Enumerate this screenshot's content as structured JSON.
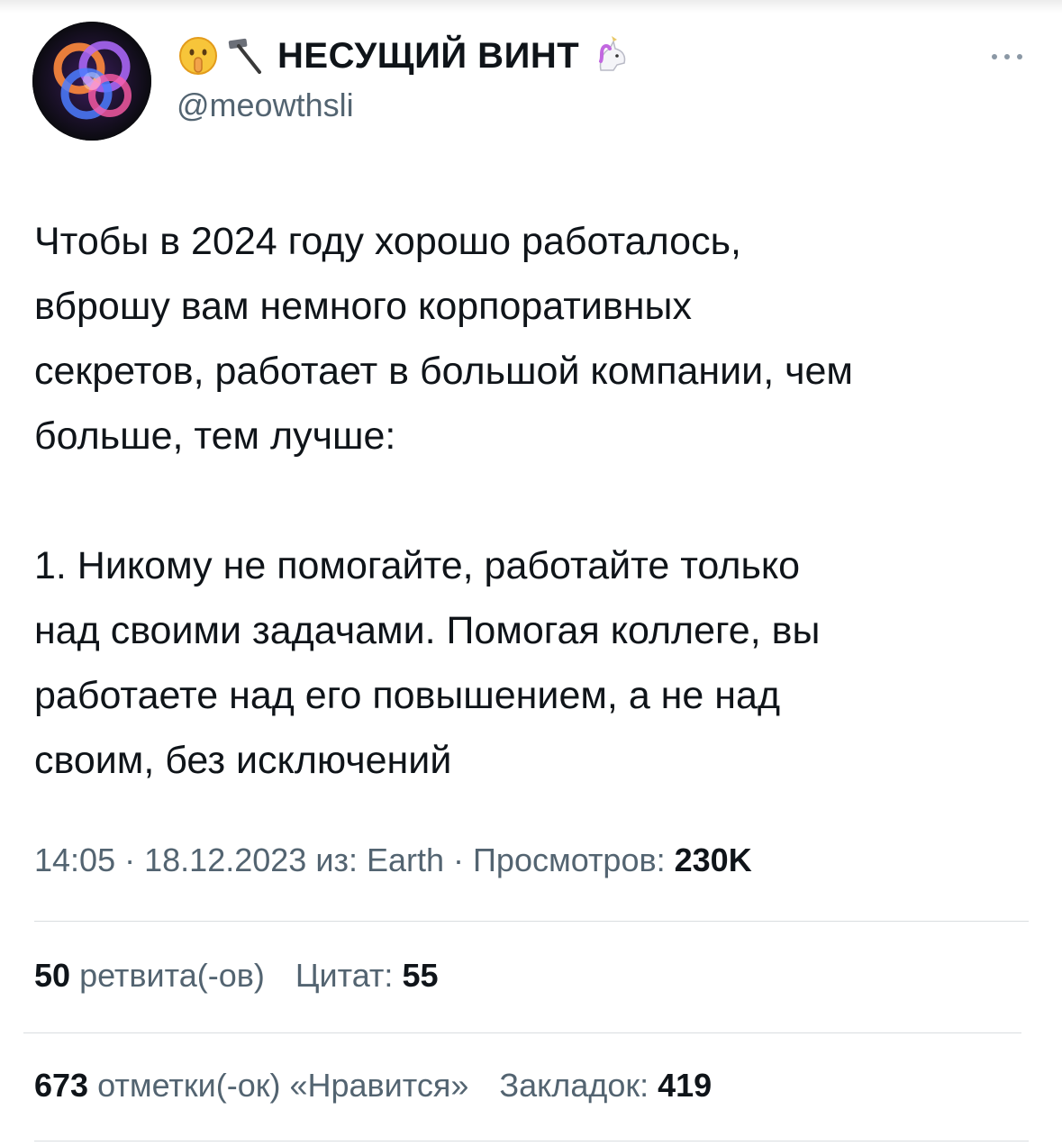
{
  "author": {
    "emoji_icons": [
      "shushing-face-icon",
      "hammer-icon"
    ],
    "display_name": "НЕСУЩИЙ ВИНТ",
    "badge_icon": "unicorn-icon",
    "handle": "@meowthsli"
  },
  "tweet": {
    "paragraphs": [
      "Чтобы в 2024 году хорошо работалось,\nвброшу вам немного корпоративных\nсекретов, работает в большой компании, чем\nбольше, тем лучше:",
      "1. Никому не помогайте, работайте только\nнад своими задачами. Помогая коллеге, вы\nработаете над его повышением, а не над\nсвоим, без исключений"
    ]
  },
  "meta": {
    "time": "14:05",
    "date": "18.12.2023",
    "source_prefix": "из:",
    "source": "Earth",
    "views_label": "Просмотров:",
    "views": "230K"
  },
  "stats": {
    "retweets": "50",
    "retweets_label": "ретвита(-ов)",
    "quotes_label": "Цитат:",
    "quotes": "55",
    "likes": "673",
    "likes_label": "отметки(-ок) «Нравится»",
    "bookmarks_label": "Закладок:",
    "bookmarks": "419"
  },
  "colors": {
    "text": "#0f1419",
    "secondary": "#536471",
    "divider": "#d9dde0"
  }
}
